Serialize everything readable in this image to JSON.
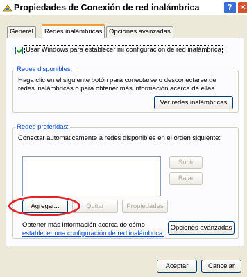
{
  "window": {
    "title": "Propiedades de Conexión de red inalámbrica",
    "help_label": "?",
    "close_label": "✕"
  },
  "tabs": [
    {
      "label": "General",
      "active": false
    },
    {
      "label": "Redes inalámbricas",
      "active": true
    },
    {
      "label": "Opciones avanzadas",
      "active": false
    }
  ],
  "use_windows_checkbox": {
    "label": "Usar Windows para establecer mi configuración de red inalámbrica",
    "checked": true
  },
  "available_networks": {
    "title": "Redes disponibles:",
    "description": "Haga clic en el siguiente botón para conectarse o desconectarse de redes inalámbricas o para obtener más información acerca de ellas.",
    "view_button": "Ver redes inalámbricas"
  },
  "preferred_networks": {
    "title": "Redes preferidas:",
    "description": "Conectar automáticamente a redes disponibles en el orden siguiente:",
    "up_button": "Subir",
    "down_button": "Bajar",
    "add_button": "Agregar...",
    "remove_button": "Quitar",
    "properties_button": "Propiedades"
  },
  "footer_info": {
    "text": "Obtener más información acerca de cómo",
    "link": "establecer una configuración de red inalámbrica.",
    "advanced_button": "Opciones avanzadas"
  },
  "dialog_buttons": {
    "ok": "Aceptar",
    "cancel": "Cancelar"
  },
  "colors": {
    "dialog_bg": "#ece9d8",
    "panel_bg": "#fcfcfe",
    "group_title": "#0046d5",
    "highlight_ring": "#e2232a"
  }
}
